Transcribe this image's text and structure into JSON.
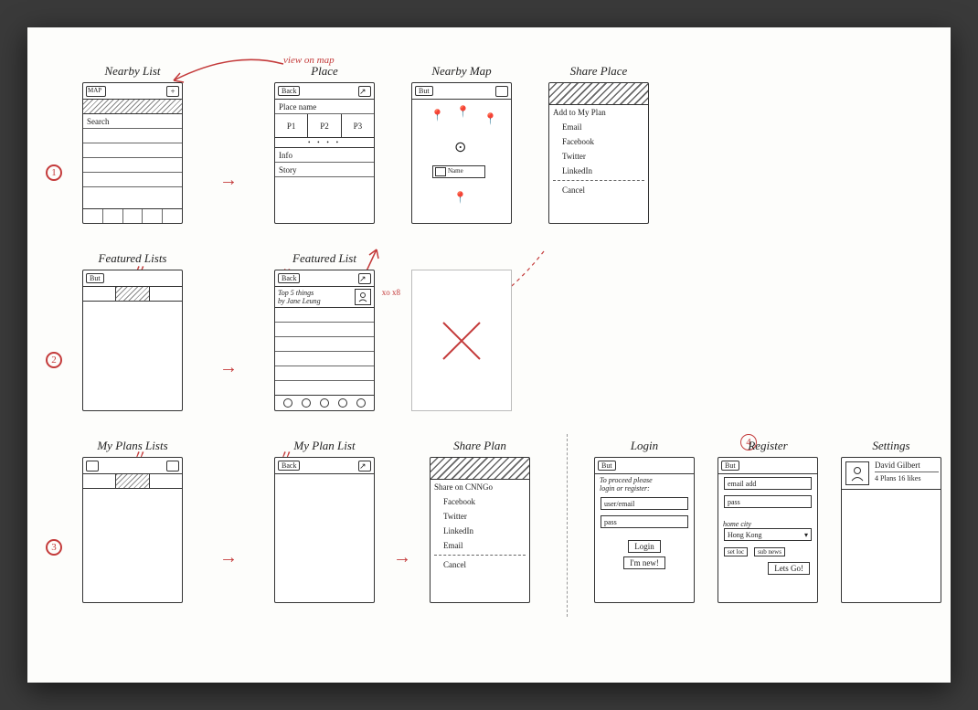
{
  "annotation_view_on_map": "view on map",
  "badge_xo": "xo x8",
  "row_markers": [
    "1",
    "2",
    "3",
    "4"
  ],
  "screens": {
    "nearby_list": {
      "title": "Nearby List",
      "topbar_left": "MAP",
      "search": "Search"
    },
    "place": {
      "title": "Place",
      "back": "Back",
      "name_row": "Place name",
      "photos": [
        "P1",
        "P2",
        "P3"
      ],
      "rows": [
        "Info",
        "Story"
      ]
    },
    "nearby_map": {
      "title": "Nearby Map",
      "back": "But",
      "callout_label": "Name"
    },
    "share_place": {
      "title": "Share Place",
      "items": [
        "Add to My Plan",
        "Email",
        "Facebook",
        "Twitter",
        "LinkedIn"
      ],
      "cancel": "Cancel"
    },
    "featured_lists": {
      "title": "Featured Lists",
      "back": "But"
    },
    "featured_list": {
      "title": "Featured List",
      "back": "Back",
      "header_line1": "Top 5 things",
      "header_line2": "by Jane Leung"
    },
    "my_plans_lists": {
      "title": "My Plans Lists"
    },
    "my_plan_list": {
      "title": "My Plan List",
      "back": "Back"
    },
    "share_plan": {
      "title": "Share Plan",
      "header": "Share on CNNGo",
      "items": [
        "Facebook",
        "Twitter",
        "LinkedIn",
        "Email"
      ],
      "cancel": "Cancel"
    },
    "login": {
      "title": "Login",
      "back": "But",
      "prompt1": "To proceed please",
      "prompt2": "login or register:",
      "field_user": "user/email",
      "field_pass": "pass",
      "btn_login": "Login",
      "btn_new": "I'm new!"
    },
    "register": {
      "title": "Register",
      "back": "But",
      "field_email": "email add",
      "field_pass": "pass",
      "field_city_label": "home city",
      "field_city_value": "Hong Kong",
      "btn_set": "set loc",
      "btn_sub": "sub news",
      "btn_go": "Lets Go!"
    },
    "settings": {
      "title": "Settings",
      "name": "David Gilbert",
      "stats": "4 Plans 16 likes"
    }
  }
}
